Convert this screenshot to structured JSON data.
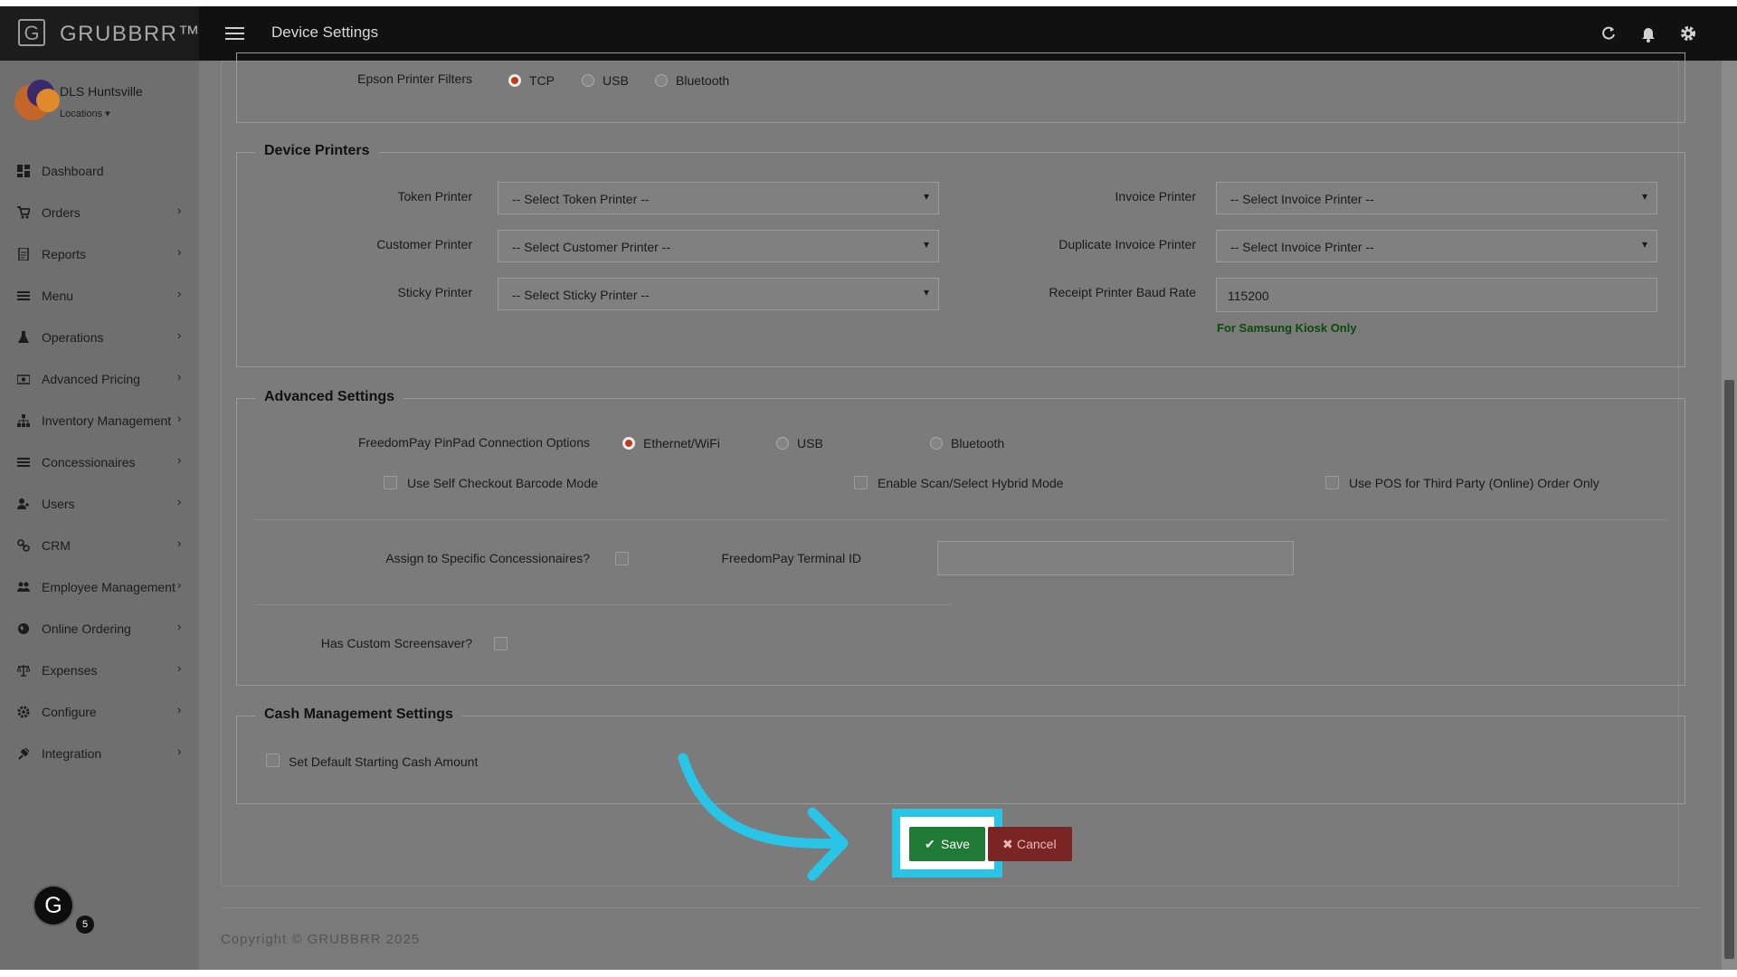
{
  "header": {
    "brand": "GRUBBRR™",
    "brand_glyph": "G",
    "page_title": "Device Settings",
    "icons": [
      "hamburger-icon",
      "refresh-icon",
      "bell-icon",
      "gear-icon"
    ]
  },
  "sidebar": {
    "profile": {
      "name": "DLS Huntsville",
      "locations_label": "Locations"
    },
    "items": [
      {
        "label": "Dashboard",
        "icon": "dashboard-icon",
        "has_children": false
      },
      {
        "label": "Orders",
        "icon": "cart-icon",
        "has_children": true
      },
      {
        "label": "Reports",
        "icon": "report-icon",
        "has_children": true
      },
      {
        "label": "Menu",
        "icon": "list-icon",
        "has_children": true
      },
      {
        "label": "Operations",
        "icon": "flask-icon",
        "has_children": true
      },
      {
        "label": "Advanced Pricing",
        "icon": "money-icon",
        "has_children": true
      },
      {
        "label": "Inventory Management",
        "icon": "sitemap-icon",
        "has_children": true
      },
      {
        "label": "Concessionaires",
        "icon": "list-icon",
        "has_children": true
      },
      {
        "label": "Users",
        "icon": "user-plus-icon",
        "has_children": true
      },
      {
        "label": "CRM",
        "icon": "link-icon",
        "has_children": true
      },
      {
        "label": "Employee Management",
        "icon": "users-icon",
        "has_children": true
      },
      {
        "label": "Online Ordering",
        "icon": "globe-icon",
        "has_children": true
      },
      {
        "label": "Expenses",
        "icon": "scale-icon",
        "has_children": true
      },
      {
        "label": "Configure",
        "icon": "cog-icon",
        "has_children": true
      },
      {
        "label": "Integration",
        "icon": "plug-icon",
        "has_children": true
      }
    ],
    "grammarly_glyph": "G",
    "grammarly_badge": "5"
  },
  "epson": {
    "label": "Epson Printer Filters",
    "options": [
      "TCP",
      "USB",
      "Bluetooth"
    ],
    "selected": "TCP"
  },
  "device_printers": {
    "legend": "Device Printers",
    "token_label": "Token Printer",
    "token_value": "-- Select Token Printer --",
    "customer_label": "Customer Printer",
    "customer_value": "-- Select Customer Printer --",
    "sticky_label": "Sticky Printer",
    "sticky_value": "-- Select Sticky Printer --",
    "invoice_label": "Invoice Printer",
    "invoice_value": "-- Select Invoice Printer --",
    "duplicate_label": "Duplicate Invoice Printer",
    "duplicate_value": "-- Select Invoice Printer --",
    "baud_label": "Receipt Printer Baud Rate",
    "baud_value": "115200",
    "baud_note": "For Samsung Kiosk Only"
  },
  "advanced": {
    "legend": "Advanced Settings",
    "pinpad_label": "FreedomPay PinPad Connection Options",
    "pinpad_options": [
      "Ethernet/WiFi",
      "USB",
      "Bluetooth"
    ],
    "pinpad_selected": "Ethernet/WiFi",
    "self_checkout": "Use Self Checkout Barcode Mode",
    "hybrid": "Enable Scan/Select Hybrid Mode",
    "third_party": "Use POS for Third Party (Online) Order Only",
    "assign_label": "Assign to Specific Concessionaires?",
    "terminal_label": "FreedomPay Terminal ID",
    "terminal_value": "",
    "screensaver_label": "Has Custom Screensaver?"
  },
  "cash": {
    "legend": "Cash Management Settings",
    "default_cash": "Set Default Starting Cash Amount"
  },
  "actions": {
    "save": "Save",
    "cancel": "Cancel",
    "save_icon": "check-icon",
    "cancel_icon": "times-icon"
  },
  "footer": {
    "copyright": "Copyright © GRUBBRR 2025"
  },
  "colors": {
    "header_bg": "#111111",
    "save_green": "#1e7a34",
    "cancel_red": "#7a2424",
    "highlight_cyan": "#29c4e6",
    "note_green": "#0c4a0c",
    "radio_selected": "#c03a1e"
  }
}
